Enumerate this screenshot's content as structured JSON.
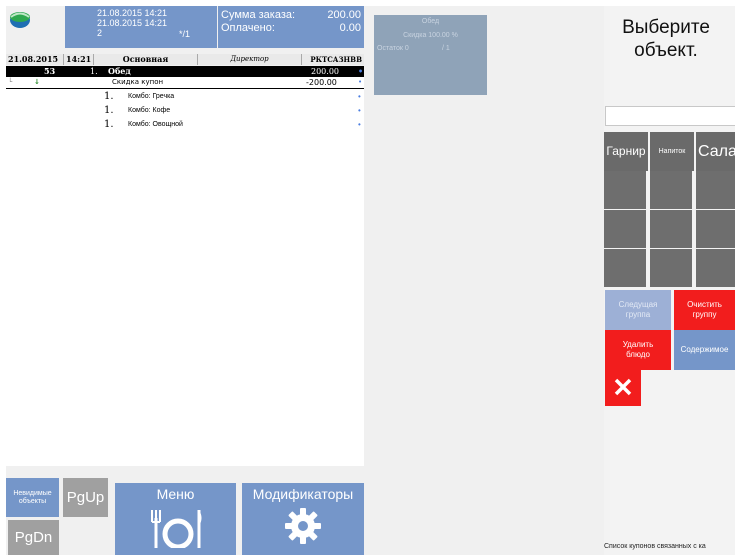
{
  "header": {
    "time1": "21.08.2015 14:21",
    "time2": "21.08.2015 14:21",
    "guests": "2",
    "table": "*/1",
    "order_sum_label": "Сумма заказа:",
    "order_sum_value": "200.00",
    "paid_label": "Оплачено:",
    "paid_value": "0.00"
  },
  "infobar": {
    "date": "21.08.2015",
    "time": "14:21",
    "menu": "Основная",
    "role": "Директор",
    "user": "РКТСАЗНВВ"
  },
  "order": {
    "table_no": "53",
    "line_no": "1.",
    "dish_name": "Обед",
    "dish_price": "200.00",
    "discount_name": "Скидка купон",
    "discount_value": "-200.00",
    "components": [
      {
        "qty": "1.",
        "name": "Комбо: Гречка"
      },
      {
        "qty": "1.",
        "name": "Комбо: Кофе"
      },
      {
        "qty": "1.",
        "name": "Комбо: Овощной"
      }
    ]
  },
  "info_card": {
    "title": "Обед",
    "discount": "Скидка 100.00 %",
    "rest_label": "Остаток 0",
    "rest_value": "/ 1"
  },
  "selector": {
    "title_line1": "Выберите",
    "title_line2": "объект.",
    "categories": [
      "Гарнир",
      "Напиток",
      "Салат"
    ]
  },
  "actions": {
    "next_group": "Следущая группа",
    "clear_group": "Очистить группу",
    "delete_dish": "Удалить блюдо",
    "contents": "Содержимое"
  },
  "bottom": {
    "hidden_objects": "Невидимые объекты",
    "pgup": "PgUp",
    "pgdn": "PgDn",
    "menu": "Меню",
    "modifiers": "Модификаторы"
  },
  "status_text": "Список купонов связанных с ка",
  "colors": {
    "accent_blue": "#7596c9",
    "red": "#f21d1d",
    "dark_button": "#6a6a6a"
  }
}
